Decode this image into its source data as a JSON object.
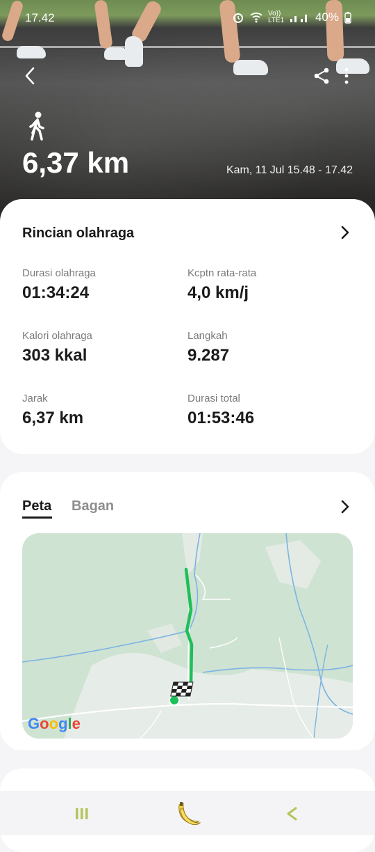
{
  "status_bar": {
    "time": "17.42",
    "network": "Vo)) LTE1",
    "battery": "40%"
  },
  "header": {
    "activity_icon": "walking-person-icon",
    "distance": "6,37 km",
    "datetime": "Kam, 11 Jul 15.48 - 17.42"
  },
  "details": {
    "title": "Rincian olahraga",
    "metrics": [
      {
        "label": "Durasi olahraga",
        "value": "01:34:24"
      },
      {
        "label": "Kcptn rata-rata",
        "value": "4,0 km/j"
      },
      {
        "label": "Kalori olahraga",
        "value": "303 kkal"
      },
      {
        "label": "Langkah",
        "value": "9.287"
      },
      {
        "label": "Jarak",
        "value": "6,37 km"
      },
      {
        "label": "Durasi total",
        "value": "01:53:46"
      }
    ]
  },
  "map_card": {
    "tabs": [
      {
        "label": "Peta",
        "active": true
      },
      {
        "label": "Bagan",
        "active": false
      }
    ],
    "map_brand": [
      "G",
      "o",
      "o",
      "g",
      "l",
      "e"
    ]
  },
  "colors": {
    "route": "#1ebf58",
    "map_land": "#cfe3d3",
    "nav_accent": "#b5c35a"
  }
}
